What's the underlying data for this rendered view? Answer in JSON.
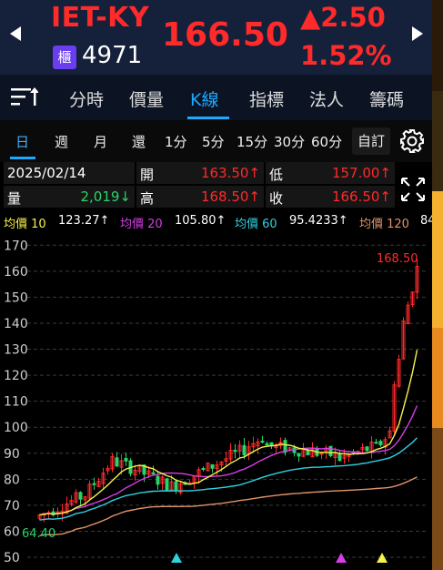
{
  "header": {
    "prev_icon": "left-triangle-icon",
    "next_icon": "right-triangle-icon",
    "ticker": "IET-KY",
    "market_badge": "櫃",
    "code": "4971",
    "price": "166.50",
    "change": "▲2.50",
    "change_pct": "1.52%"
  },
  "tabs": {
    "menu_icon": "sort-menu-icon",
    "items": [
      "分時",
      "價量",
      "K線",
      "指標",
      "法人",
      "籌碼"
    ],
    "active": "K線"
  },
  "periods": {
    "items": [
      "日",
      "週",
      "月",
      "還",
      "1分",
      "5分",
      "15分",
      "30分",
      "60分"
    ],
    "active": "日",
    "custom_label": "自訂",
    "settings_icon": "gear-icon"
  },
  "info": {
    "date": "2025/02/14",
    "open_label": "開",
    "open": "163.50↑",
    "low_label": "低",
    "low": "157.00↑",
    "vol_label": "量",
    "vol": "2,019↓",
    "high_label": "高",
    "high": "168.50↑",
    "close_label": "收",
    "close": "166.50↑",
    "expand_icon": "expand-arrows-icon"
  },
  "ma": {
    "ma10_label": "均價 10",
    "ma10": "123.27↑",
    "ma20_label": "均價 20",
    "ma20": "105.80↑",
    "ma60_label": "均價 60",
    "ma60": "95.4233↑",
    "ma120_label": "均價 120",
    "ma120": "84"
  },
  "colors": {
    "up": "#ff2a2a",
    "down": "#2bd36a",
    "accent": "#1ea9ff",
    "ma10": "#f5f24a",
    "ma20": "#d63ee6",
    "ma60": "#2fd0e0",
    "ma120": "#e0946a"
  },
  "chart_data": {
    "type": "candlestick",
    "y_ticks": [
      170,
      160,
      150,
      140,
      130,
      120,
      110,
      100,
      90,
      80,
      70,
      60,
      50
    ],
    "ylim": [
      50,
      175
    ],
    "max_label": "168.50",
    "min_label": "64.40",
    "grid": true
  }
}
